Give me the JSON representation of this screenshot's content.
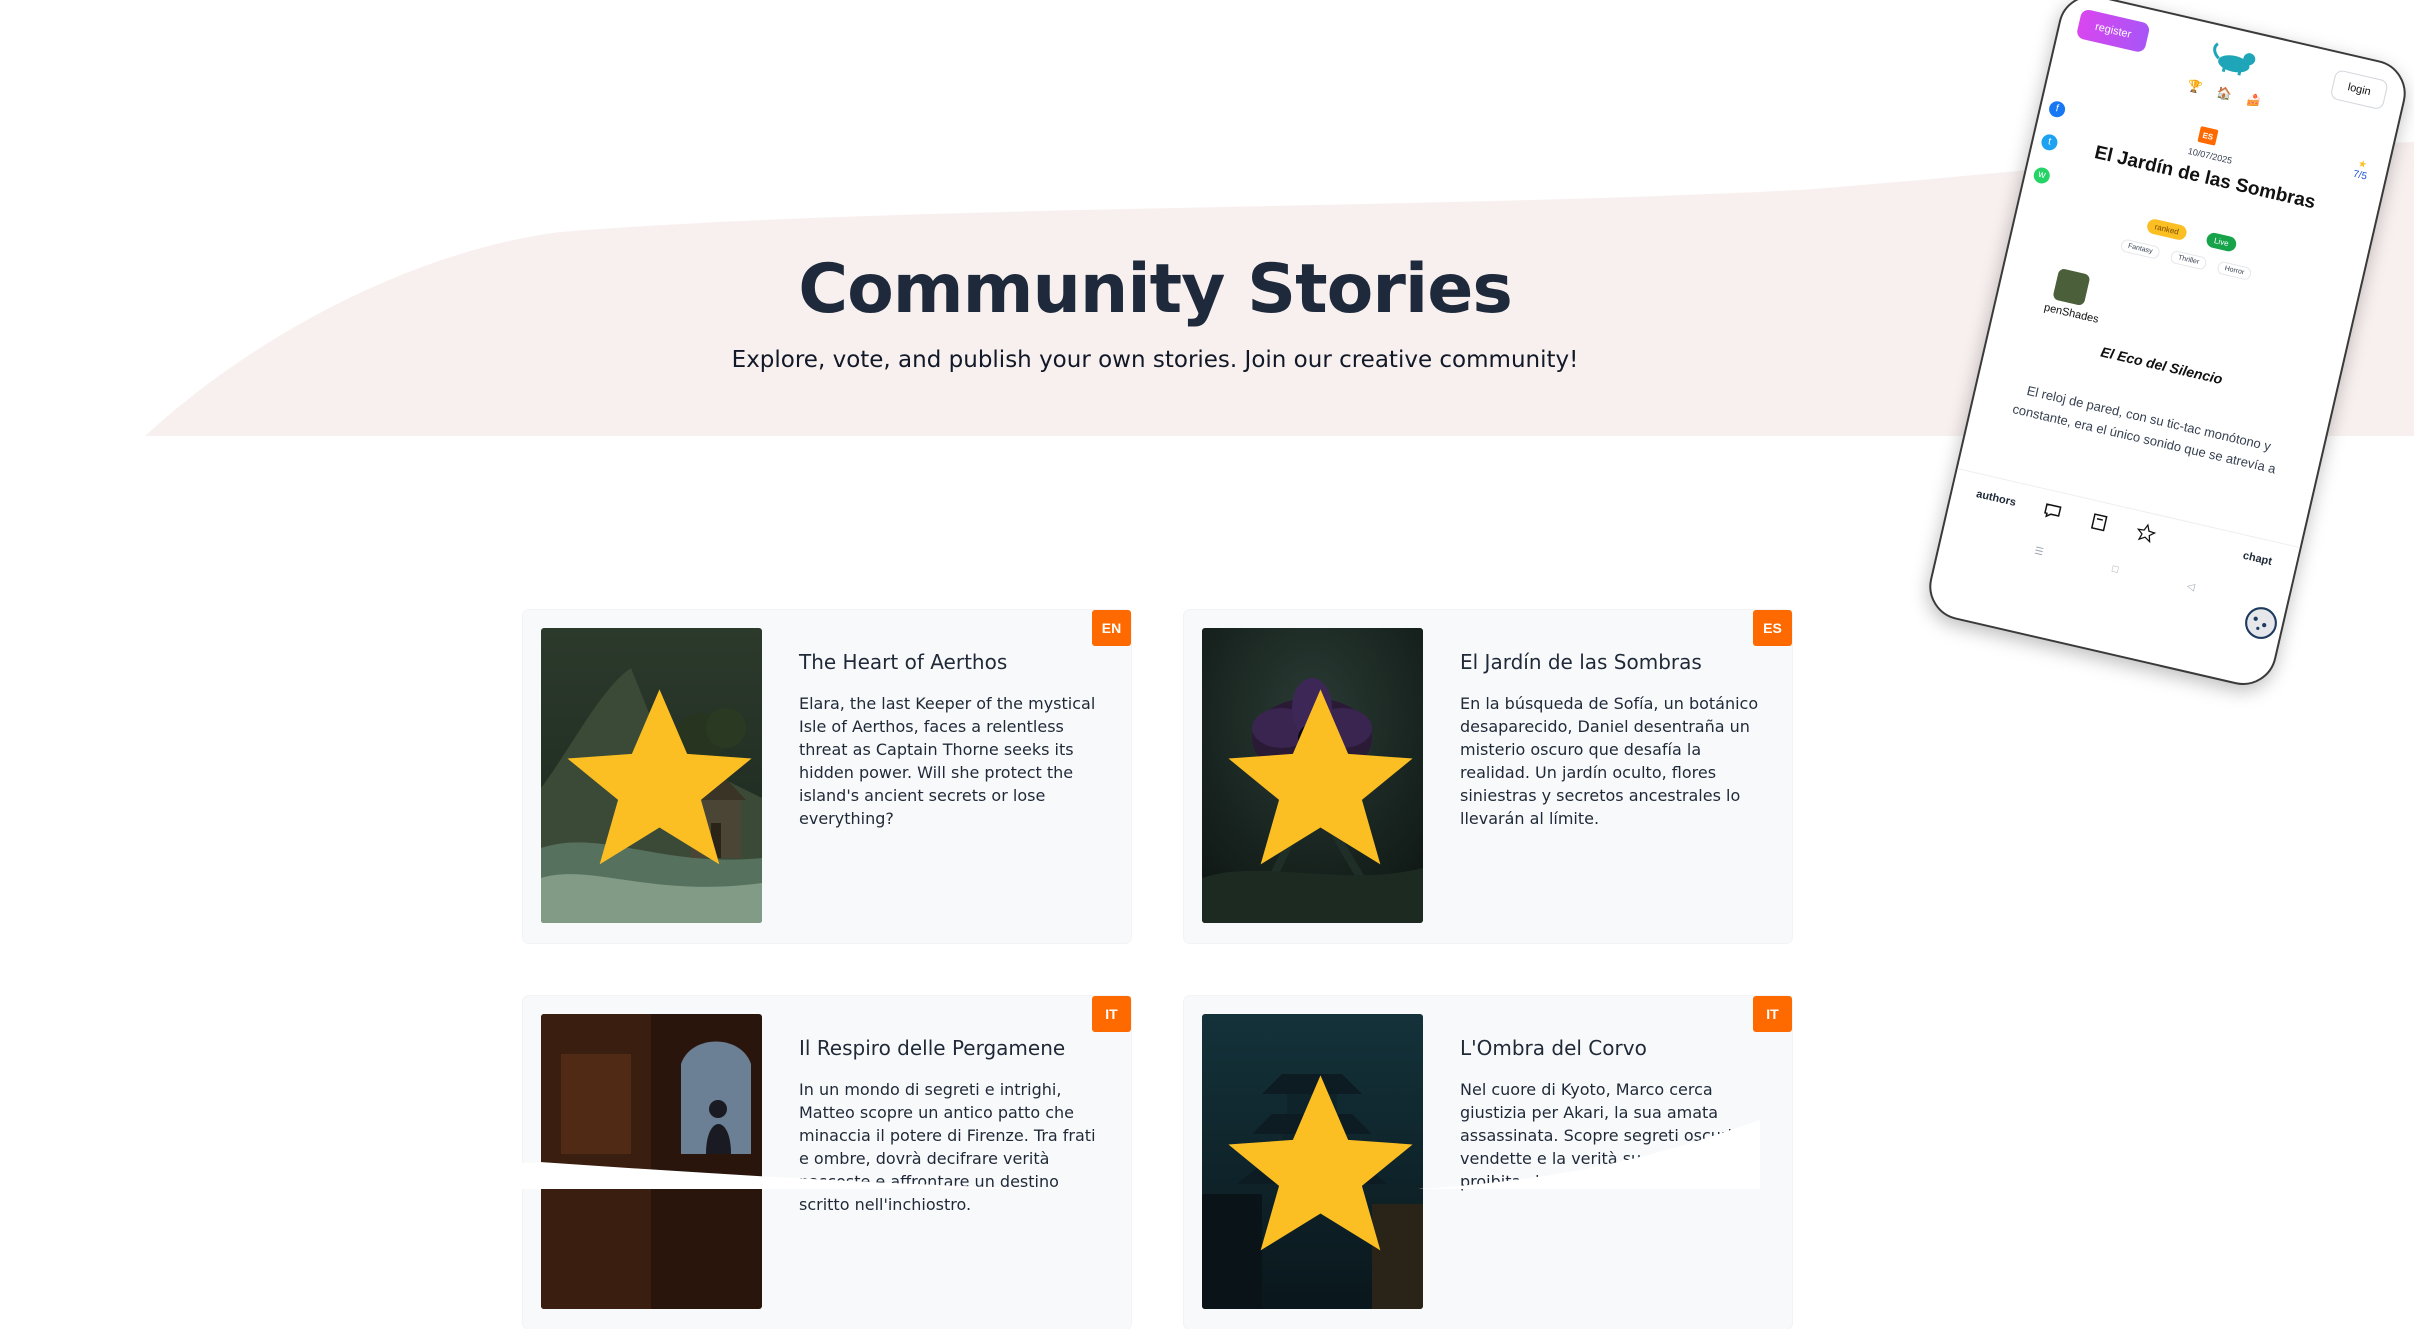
{
  "hero": {
    "title": "Community Stories",
    "subtitle": "Explore, vote, and publish your own stories. Join our creative community!"
  },
  "colors": {
    "accent_orange": "#ff6a00",
    "star_yellow": "#fbbf24",
    "hero_title": "#1e293b",
    "wave_tint": "#f8f0ef",
    "card_bg": "#f8f9fb"
  },
  "stories": [
    {
      "title": "The Heart of Aerthos",
      "description": "Elara, the last Keeper of the mystical Isle of Aerthos, faces a relentless threat as Captain Thorne seeks its hidden power. Will she protect the island's ancient secrets or lose everything?",
      "lang": "EN",
      "featured": true
    },
    {
      "title": "El Jardín de las Sombras",
      "description": "En la búsqueda de Sofía, un botánico desaparecido, Daniel desentraña un misterio oscuro que desafía la realidad. Un jardín oculto, flores siniestras y secretos ancestrales lo llevarán al límite.",
      "lang": "ES",
      "featured": true
    },
    {
      "title": "Il Respiro delle Pergamene",
      "description": "In un mondo di segreti e intrighi, Matteo scopre un antico patto che minaccia il potere di Firenze. Tra frati e ombre, dovrà decifrare verità nascoste e affrontare un destino scritto nell'inchiostro.",
      "lang": "IT",
      "featured": false
    },
    {
      "title": "L'Ombra del Corvo",
      "description": "Nel cuore di Kyoto, Marco cerca giustizia per Akari, la sua amata assassinata. Scopre segreti oscuri, vendette e la verità su una formula proibita che minaccia l'anima.",
      "lang": "IT",
      "featured": true
    }
  ],
  "phone": {
    "register_label": "register",
    "login_label": "login",
    "top_icons": [
      "trophy-icon",
      "home-icon",
      "cake-icon"
    ],
    "lang": "ES",
    "date": "10/07/2025",
    "title": "El Jardín de las Sombras",
    "rating": "7/5",
    "badges": [
      "ranked",
      "Live"
    ],
    "genres": [
      "Fantasy",
      "Thriller",
      "Horror"
    ],
    "author": "penShades",
    "story_title": "El Eco del Silencio",
    "excerpt": "El reloj de pared, con su tic-tac monótono y constante, era el único sonido que se atrevía a",
    "nav_left": "authors",
    "nav_right": "chapt",
    "social": [
      "facebook-icon",
      "twitter-icon",
      "whatsapp-icon"
    ]
  }
}
